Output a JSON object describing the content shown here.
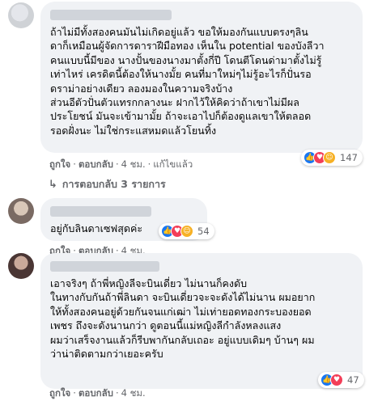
{
  "comments": [
    {
      "text": "ถ้าไม่มีทั้งสองคนมันไม่เกิดอยู่แล้ว ขอให้มองกันแบบตรงๆลิน\nดาก็เหมือนผู้จัดการดาราฝีมือทอง เห็นใน potential ของบังลีวา\nคนแบบนี้มีของ นางปั้นของนางมาตั้งกี่ปี โดนตีโดนด่ามาตั้งไม่รู้\nเท่าไหร่ เครดิตนี้ต้องให้นางมั้ย คนที่มาใหม่ๆไม่รู้อะไรก็ปั่นรอ\nดราม่าอย่างเดียว ลองมองในความจริงบ้าง\nส่วนอีตัวปั่นตัวแทรกกลางนะ ฝากไว้ให้คิดว่าถ้าเขาไม่มีผล\nประโยชน์ มันจะเข้ามามั้ย ถ้าจะเอาไปก็ต้องดูแลเขาให้ตลอด\nรอดฝั่งนะ ไม่ใช่กระแสหมดแล้วโยนทิ้ง",
      "like": "ถูกใจ",
      "reply": "ตอบกลับ",
      "time": "4 ชม.",
      "edited": "แก้ไขแล้ว",
      "reaction_count": "147"
    },
    {
      "text": "อยู่กับลินดาเซฟสุดค่ะ",
      "like": "ถูกใจ",
      "reply": "ตอบกลับ",
      "time": "4 ชม.",
      "reaction_count": "54"
    },
    {
      "text": "เอาจริงๆ ถ้าพี่หญิงลีจะบินเดี่ยว ไม่นานก็คงดับ\nในทางกับกันถ้าพี่ลินดา จะบินเดี่ยวจะจะดังได้ไม่นาน ผมอยาก\nให้ทั้งสองคนอยู่ด้วยกันจนแก่เฒ่า ไม่เท่ายอดทองกระบองยอด\nเพชร ถึงจะดังนานกว่า ดูตอนนี้แม่หญิงลีกำลังหลงแสง\nผมว่าเสร็จงานแล้วก็รีบพากันกลับเถอะ อยู่แบบเดิมๆ บ้านๆ ผม\nว่าน่าติดตามกว่าเยอะครับ",
      "like": "ถูกใจ",
      "reply": "ตอบกลับ",
      "time": "4 ชม.",
      "reaction_count": "47"
    }
  ],
  "replies_link": "การตอบกลับ 3 รายการ",
  "separator": "·",
  "colors": {
    "like": "#1877f2",
    "love": "#f33e58",
    "care": "#f7b125",
    "bubble": "#f0f2f5"
  },
  "icons": {
    "like": "thumbs-up-icon",
    "love": "heart-icon",
    "care": "care-face-icon",
    "replies": "reply-arrow-icon"
  }
}
